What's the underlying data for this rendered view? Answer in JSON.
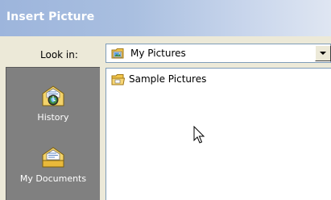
{
  "window": {
    "title": "Insert Picture"
  },
  "look_in": {
    "label": "Look in:",
    "value": "My Pictures",
    "icon": "my-pictures-folder-icon"
  },
  "places_bar": {
    "items": [
      {
        "label": "History",
        "icon": "history-icon"
      },
      {
        "label": "My Documents",
        "icon": "my-documents-icon"
      }
    ]
  },
  "file_list": {
    "items": [
      {
        "label": "Sample Pictures",
        "icon": "folder-icon"
      }
    ]
  },
  "colors": {
    "title_gradient_start": "#9db5dc",
    "title_gradient_end": "#dfe6f2",
    "dialog_background": "#ece9d8",
    "places_bar": "#808080"
  }
}
